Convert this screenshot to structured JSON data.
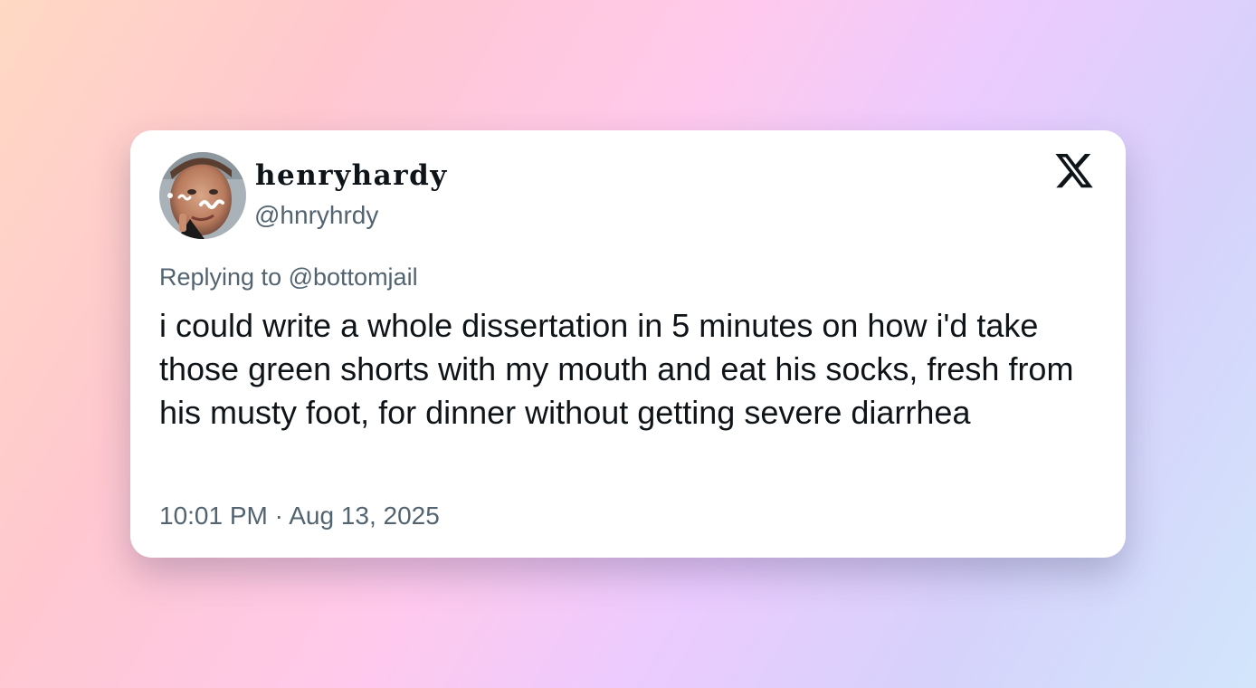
{
  "tweet": {
    "display_name": "henryhardy",
    "handle": "@hnryhrdy",
    "reply_prefix": "Replying to",
    "reply_to": "@bottomjail",
    "text": "i could write a whole dissertation in 5 minutes on how i'd take those green shorts with my mouth and eat his socks, fresh from his musty foot, for dinner without getting severe diarrhea",
    "time": "10:01 PM",
    "separator": "·",
    "date": "Aug 13, 2025"
  },
  "icons": {
    "logo": "x-logo-icon",
    "avatar": "profile-photo"
  },
  "colors": {
    "text_primary": "#0f1419",
    "text_secondary": "#536471",
    "card_background": "#ffffff"
  }
}
